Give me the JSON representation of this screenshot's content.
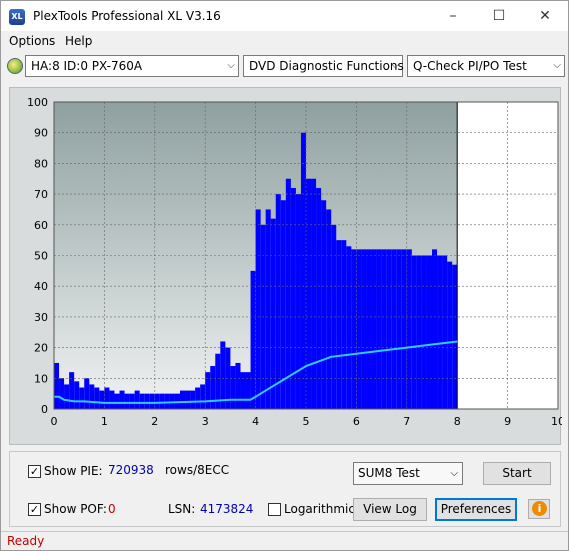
{
  "window": {
    "title": "PlexTools Professional XL V3.16",
    "app_icon_text": "XL"
  },
  "menu": {
    "options": "Options",
    "help": "Help"
  },
  "toolbar": {
    "drive": "HA:8 ID:0  PX-760A",
    "function": "DVD Diagnostic Functions",
    "test": "Q-Check PI/PO Test"
  },
  "chart_data": {
    "type": "bar",
    "x_ticks": [
      "0",
      "1",
      "2",
      "3",
      "4",
      "5",
      "6",
      "7",
      "8",
      "9",
      "10"
    ],
    "y_ticks": [
      "0",
      "10",
      "20",
      "30",
      "40",
      "50",
      "60",
      "70",
      "80",
      "90",
      "100"
    ],
    "xlim": [
      0,
      10
    ],
    "ylim": [
      0,
      100
    ],
    "data_end_x": 8,
    "grid": true,
    "colors": {
      "pie": "#0000ff",
      "cumulative": "#33ccff",
      "bg_top": "#8fa0a0",
      "bg_bottom": "#f0f2f2"
    },
    "series": [
      {
        "type": "bar",
        "color": "#0000ff",
        "x": [
          0,
          0.1,
          0.2,
          0.3,
          0.4,
          0.5,
          0.6,
          0.7,
          0.8,
          0.9,
          1.0,
          1.1,
          1.2,
          1.3,
          1.4,
          1.5,
          1.6,
          1.7,
          1.8,
          1.9,
          2.0,
          2.1,
          2.2,
          2.3,
          2.4,
          2.5,
          2.6,
          2.7,
          2.8,
          2.9,
          3.0,
          3.1,
          3.2,
          3.3,
          3.4,
          3.5,
          3.6,
          3.7,
          3.8,
          3.9,
          4.0,
          4.1,
          4.2,
          4.3,
          4.4,
          4.5,
          4.6,
          4.7,
          4.8,
          4.9,
          5.0,
          5.1,
          5.2,
          5.3,
          5.4,
          5.5,
          5.6,
          5.7,
          5.8,
          5.9,
          6.0,
          6.1,
          6.2,
          6.3,
          6.4,
          6.5,
          6.6,
          6.7,
          6.8,
          6.9,
          7.0,
          7.1,
          7.2,
          7.3,
          7.4,
          7.5,
          7.6,
          7.7,
          7.8,
          7.9
        ],
        "values": [
          15,
          10,
          8,
          12,
          9,
          7,
          10,
          8,
          7,
          6,
          7,
          6,
          5,
          6,
          5,
          5,
          6,
          5,
          5,
          5,
          5,
          5,
          5,
          5,
          5,
          6,
          6,
          6,
          7,
          8,
          12,
          14,
          18,
          22,
          20,
          14,
          15,
          12,
          12,
          45,
          65,
          60,
          65,
          62,
          70,
          68,
          75,
          72,
          70,
          90,
          75,
          75,
          72,
          68,
          65,
          60,
          55,
          55,
          53,
          52,
          52,
          52,
          52,
          52,
          52,
          52,
          52,
          52,
          52,
          52,
          52,
          50,
          50,
          50,
          50,
          52,
          50,
          50,
          48,
          47
        ]
      },
      {
        "type": "line",
        "color": "#33ccff",
        "x": [
          0,
          0.1,
          0.2,
          0.4,
          0.6,
          1,
          2,
          3,
          3.5,
          3.9,
          4.0,
          4.2,
          4.5,
          5.0,
          5.5,
          6.0,
          6.5,
          7.0,
          7.5,
          8.0
        ],
        "values": [
          4,
          4,
          3,
          2.5,
          2.5,
          2,
          2,
          2.5,
          3,
          3,
          4,
          6,
          9,
          14,
          17,
          18,
          19,
          20,
          21,
          22
        ]
      }
    ]
  },
  "controls": {
    "show_pie_label": "Show PIE:",
    "show_pie_checked": "✓",
    "pie_value": "720938",
    "rows_label": "rows/8ECC",
    "show_pof_label": "Show POF:",
    "show_pof_checked": "✓",
    "pof_value": "0",
    "lsn_label": "LSN:",
    "lsn_value": "4173824",
    "logarithmic_label": "Logarithmic",
    "sum_select": "SUM8 Test",
    "start_label": "Start",
    "view_log_label": "View Log",
    "preferences_label": "Preferences",
    "info_icon": "i"
  },
  "status": {
    "text": "Ready"
  }
}
